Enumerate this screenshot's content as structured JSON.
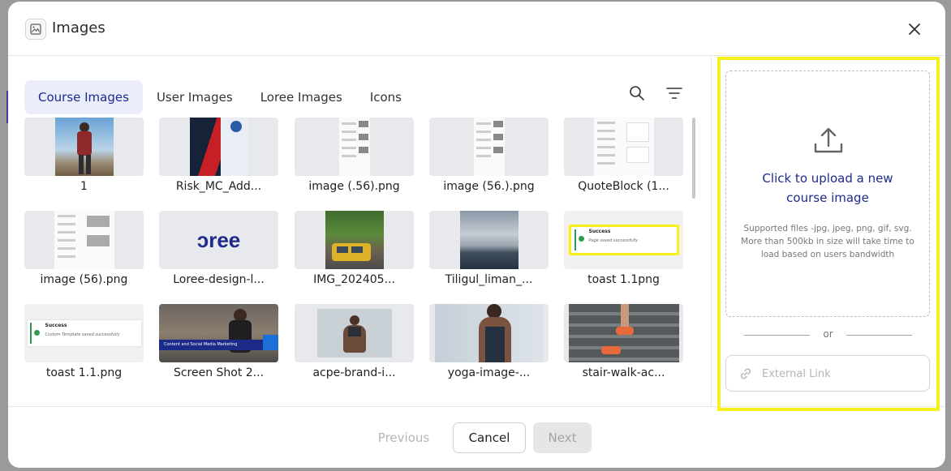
{
  "dialog": {
    "title": "Images",
    "close_icon": "close-icon",
    "header_icon": "image-icon"
  },
  "tabs": [
    {
      "label": "Course Images",
      "active": true
    },
    {
      "label": "User Images",
      "active": false
    },
    {
      "label": "Loree Images",
      "active": false
    },
    {
      "label": "Icons",
      "active": false
    }
  ],
  "toolbar": {
    "search_icon": "search-icon",
    "filter_icon": "filter-icon"
  },
  "images": [
    {
      "caption": "1"
    },
    {
      "caption": "Risk_MC_Add..."
    },
    {
      "caption": "image (.56).png"
    },
    {
      "caption": "image (56.).png"
    },
    {
      "caption": "QuoteBlock (1..."
    },
    {
      "caption": "image (56).png"
    },
    {
      "caption": "Loree-design-l..."
    },
    {
      "caption": "IMG_202405..."
    },
    {
      "caption": "Tiligul_liman_..."
    },
    {
      "caption": "toast 1.1png"
    },
    {
      "caption": "toast 1.1.png"
    },
    {
      "caption": "Screen Shot 2..."
    },
    {
      "caption": "acpe-brand-i..."
    },
    {
      "caption": "yoga-image-..."
    },
    {
      "caption": "stair-walk-ac..."
    }
  ],
  "thumb_text": {
    "loree_logo": "ɔree",
    "toast_success": "Success",
    "toast_page_saved": "Page saved successfully",
    "toast_template_saved": "Custom Template saved successfully",
    "content_banner": "Content and Social Media Marketing"
  },
  "upload": {
    "title": "Click to upload a new course image",
    "hint": "Supported files -jpg, jpeg, png, gif, svg. More than 500kb in size will take time to load based on users bandwidth",
    "or_text": "or",
    "external_link_placeholder": "External Link",
    "upload_icon": "upload-icon",
    "link_icon": "link-icon"
  },
  "footer": {
    "previous": "Previous",
    "cancel": "Cancel",
    "next": "Next"
  },
  "colors": {
    "accent": "#1e2a8c",
    "highlight": "#f7f01a",
    "active_tab_bg": "#ecedfb"
  }
}
